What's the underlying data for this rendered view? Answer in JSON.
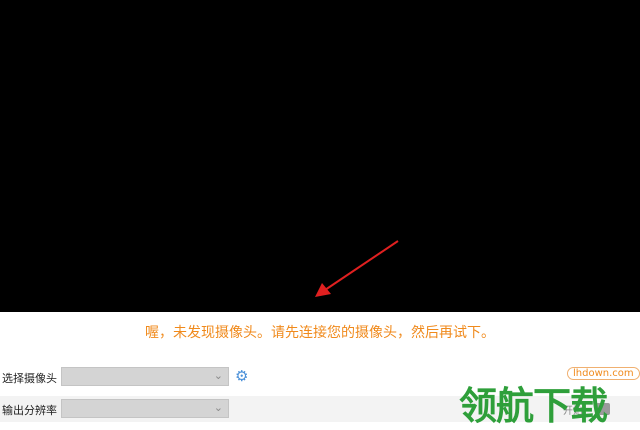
{
  "status_message": "喔，未发现摄像头。请先连接您的摄像头，然后再试下。",
  "camera": {
    "label": "选择摄像头",
    "value": ""
  },
  "resolution": {
    "label": "输出分辨率",
    "value": ""
  },
  "settings_icon": "gear-icon",
  "start": {
    "label": "开始"
  },
  "watermark": {
    "text": "领航下载",
    "url": "lhdown.com"
  },
  "colors": {
    "accent": "#f08a1c",
    "arrow": "#e02020",
    "watermark": "#2e9f3a"
  }
}
